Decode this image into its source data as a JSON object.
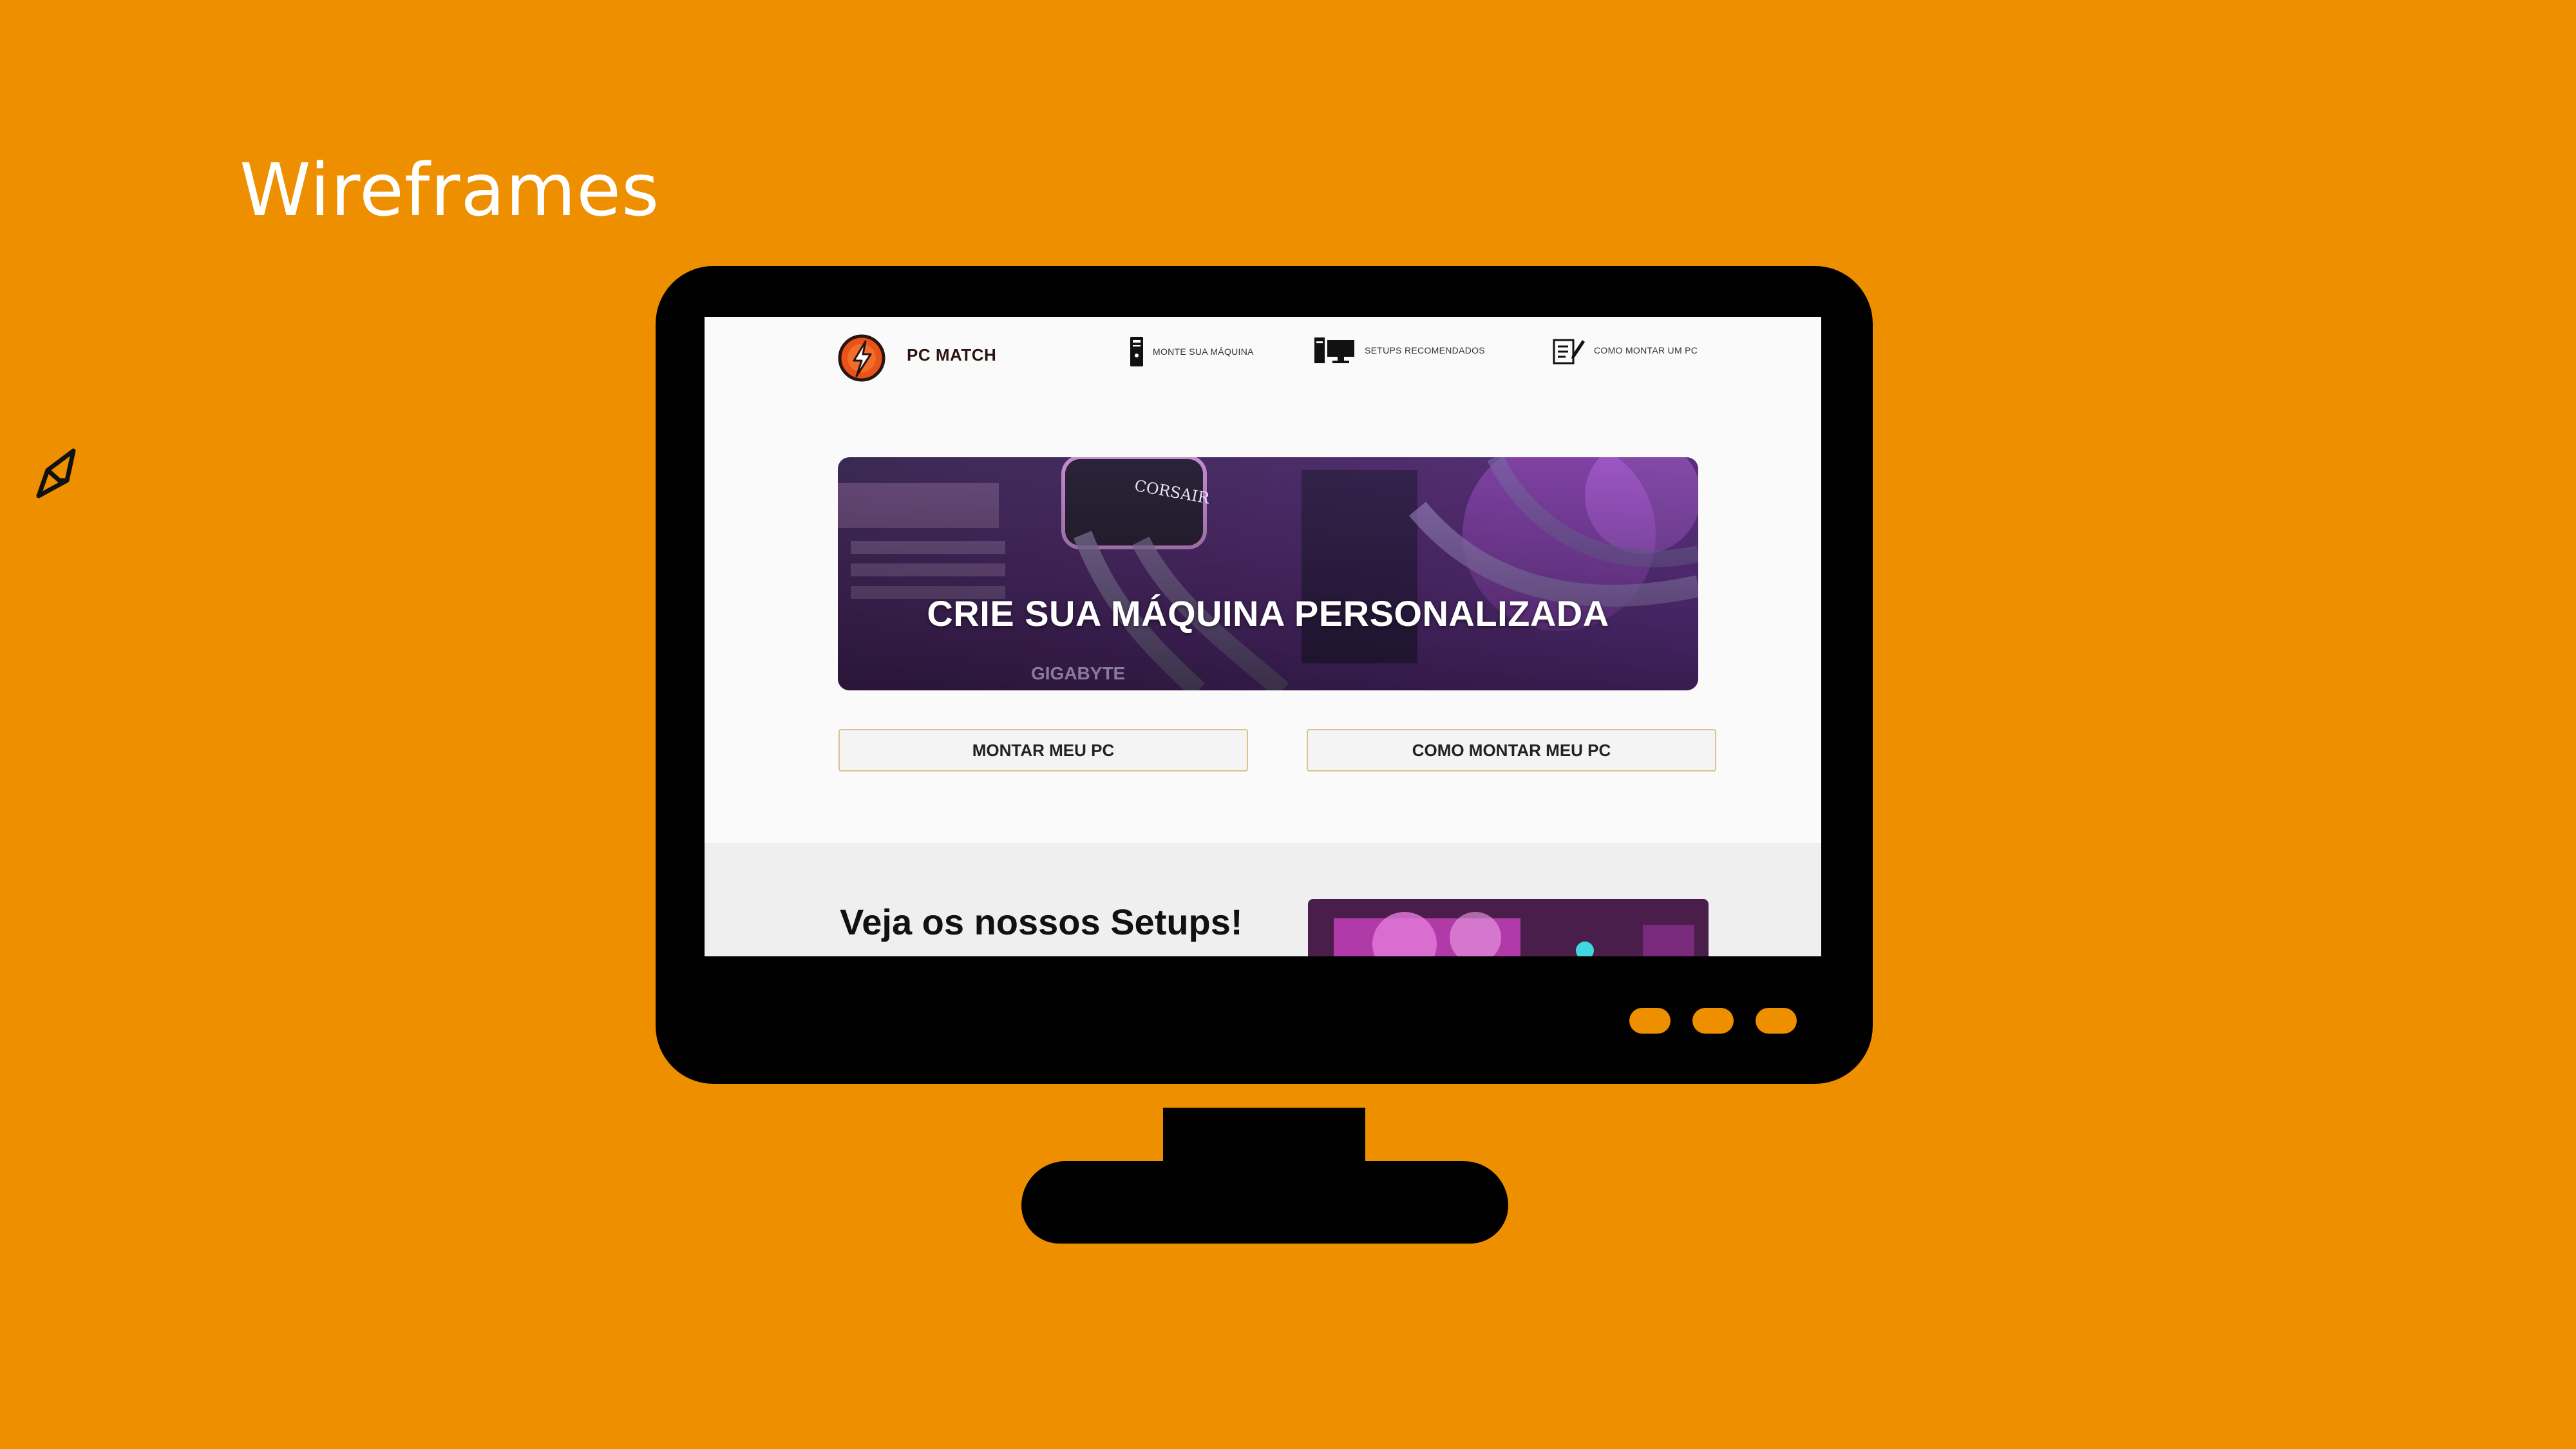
{
  "slide": {
    "title": "Wireframes"
  },
  "site": {
    "brand": "PC MATCH",
    "nav": [
      {
        "label": "MONTE SUA MÁQUINA",
        "icon": "pc-tower-icon"
      },
      {
        "label": "SETUPS RECOMENDADOS",
        "icon": "desktop-setup-icon"
      },
      {
        "label": "COMO MONTAR UM PC",
        "icon": "checklist-edit-icon"
      }
    ],
    "hero": {
      "title": "CRIE SUA MÁQUINA PERSONALIZADA",
      "image_text": [
        "CORSAIR",
        "GIGABYTE"
      ]
    },
    "buttons": {
      "build": "MONTAR MEU PC",
      "howto": "COMO MONTAR MEU PC"
    },
    "setups": {
      "title": "Veja os nossos Setups!"
    }
  },
  "colors": {
    "background": "#EE8F00",
    "monitor": "#000000",
    "button_border": "#D8C38E"
  }
}
